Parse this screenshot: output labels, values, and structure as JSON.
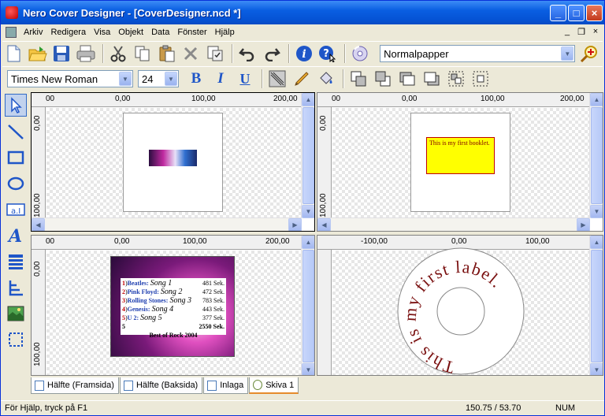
{
  "app": {
    "title": "Nero Cover Designer - [CoverDesigner.ncd *]"
  },
  "window_controls": {
    "minimize": "_",
    "maximize": "□",
    "close": "×"
  },
  "menu": {
    "items": [
      "Arkiv",
      "Redigera",
      "Visa",
      "Objekt",
      "Data",
      "Fönster",
      "Hjälp"
    ],
    "mdi": [
      "_",
      "❐",
      "×"
    ]
  },
  "toolbar": {
    "paper": "Normalpapper"
  },
  "format": {
    "font": "Times New Roman",
    "size": "24",
    "bold": "B",
    "italic": "I",
    "underline": "U"
  },
  "panes": {
    "p1": {
      "ruler_x": [
        "00",
        "0,00",
        "100,00",
        "200,00"
      ],
      "ruler_y": [
        "0,00",
        "100,00"
      ]
    },
    "p2": {
      "ruler_x": [
        "00",
        "0,00",
        "100,00",
        "200,00"
      ],
      "ruler_y": [
        "0,00",
        "100,00"
      ],
      "text": "This is my first booklet."
    },
    "p3": {
      "ruler_x": [
        "00",
        "0,00",
        "100,00",
        "200,00"
      ],
      "ruler_y": [
        "0,00",
        "100,00"
      ],
      "tracks": [
        {
          "num": "1",
          "artist": "Beatles:",
          "song": "Song 1",
          "dur": "481 Sek."
        },
        {
          "num": "2",
          "artist": "Pink Floyd:",
          "song": "Song 2",
          "dur": "472 Sek."
        },
        {
          "num": "3",
          "artist": "Rolling Stones:",
          "song": "Song 3",
          "dur": "783 Sek."
        },
        {
          "num": "4",
          "artist": "Genesis:",
          "song": "Song 4",
          "dur": "443 Sek."
        },
        {
          "num": "5",
          "artist": "U 2:",
          "song": "Song 5",
          "dur": "377 Sek."
        }
      ],
      "total_num": "5",
      "total": "2550 Sek.",
      "footer": "Best of Rock 2004"
    },
    "p4": {
      "ruler_x": [
        "-100,00",
        "0,00",
        "100,00"
      ],
      "label": "This is my first label."
    }
  },
  "tabs": [
    {
      "label": "Hälfte  (Framsida)"
    },
    {
      "label": "Hälfte  (Baksida)"
    },
    {
      "label": "Inlaga"
    },
    {
      "label": "Skiva 1"
    }
  ],
  "status": {
    "help": "För Hjälp, tryck på F1",
    "coords": "150.75 / 53.70",
    "num": "NUM"
  },
  "colors": {
    "titlebar": "#0553d4",
    "accent_red": "#c00000",
    "booklet_yellow": "#ffff00",
    "label_text": "#7a1010"
  }
}
